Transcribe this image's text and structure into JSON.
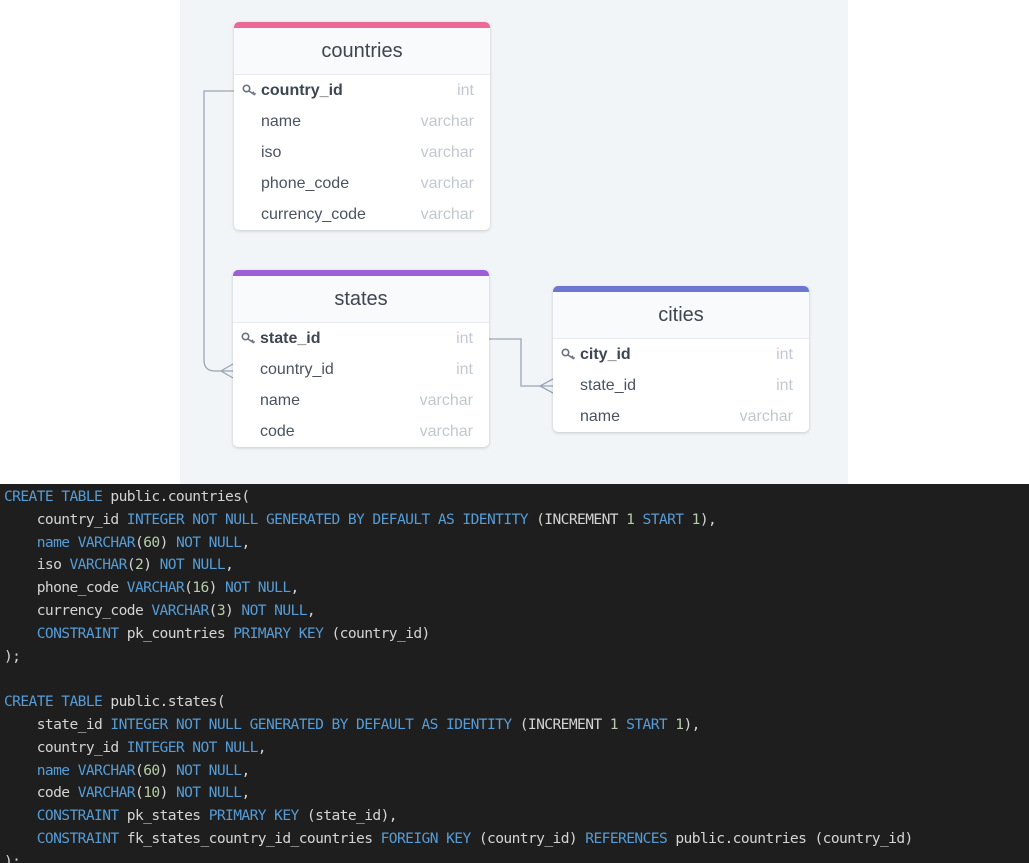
{
  "diagram": {
    "tables": [
      {
        "name": "countries",
        "color": "#ea6a95",
        "fields": [
          {
            "name": "country_id",
            "type": "int",
            "pk": true
          },
          {
            "name": "name",
            "type": "varchar",
            "pk": false
          },
          {
            "name": "iso",
            "type": "varchar",
            "pk": false
          },
          {
            "name": "phone_code",
            "type": "varchar",
            "pk": false
          },
          {
            "name": "currency_code",
            "type": "varchar",
            "pk": false
          }
        ]
      },
      {
        "name": "states",
        "color": "#9c5fd6",
        "fields": [
          {
            "name": "state_id",
            "type": "int",
            "pk": true
          },
          {
            "name": "country_id",
            "type": "int",
            "pk": false
          },
          {
            "name": "name",
            "type": "varchar",
            "pk": false
          },
          {
            "name": "code",
            "type": "varchar",
            "pk": false
          }
        ]
      },
      {
        "name": "cities",
        "color": "#6c78cf",
        "fields": [
          {
            "name": "city_id",
            "type": "int",
            "pk": true
          },
          {
            "name": "state_id",
            "type": "int",
            "pk": false
          },
          {
            "name": "name",
            "type": "varchar",
            "pk": false
          }
        ]
      }
    ]
  },
  "code": {
    "lines": [
      [
        [
          "kw",
          "CREATE TABLE"
        ],
        [
          "p",
          " public.countries("
        ]
      ],
      [
        [
          "p",
          "    country_id "
        ],
        [
          "kw",
          "INTEGER NOT NULL GENERATED BY DEFAULT AS IDENTITY"
        ],
        [
          "p",
          " (INCREMENT "
        ],
        [
          "num",
          "1"
        ],
        [
          "kw",
          " START"
        ],
        [
          "p",
          " "
        ],
        [
          "num",
          "1"
        ],
        [
          "p",
          "),"
        ]
      ],
      [
        [
          "p",
          "    "
        ],
        [
          "kw",
          "name"
        ],
        [
          "p",
          " "
        ],
        [
          "kw",
          "VARCHAR"
        ],
        [
          "p",
          "("
        ],
        [
          "num",
          "60"
        ],
        [
          "p",
          ") "
        ],
        [
          "kw",
          "NOT NULL"
        ],
        [
          "p",
          ","
        ]
      ],
      [
        [
          "p",
          "    iso "
        ],
        [
          "kw",
          "VARCHAR"
        ],
        [
          "p",
          "("
        ],
        [
          "num",
          "2"
        ],
        [
          "p",
          ") "
        ],
        [
          "kw",
          "NOT NULL"
        ],
        [
          "p",
          ","
        ]
      ],
      [
        [
          "p",
          "    phone_code "
        ],
        [
          "kw",
          "VARCHAR"
        ],
        [
          "p",
          "("
        ],
        [
          "num",
          "16"
        ],
        [
          "p",
          ") "
        ],
        [
          "kw",
          "NOT NULL"
        ],
        [
          "p",
          ","
        ]
      ],
      [
        [
          "p",
          "    currency_code "
        ],
        [
          "kw",
          "VARCHAR"
        ],
        [
          "p",
          "("
        ],
        [
          "num",
          "3"
        ],
        [
          "p",
          ") "
        ],
        [
          "kw",
          "NOT NULL"
        ],
        [
          "p",
          ","
        ]
      ],
      [
        [
          "p",
          "    "
        ],
        [
          "kw",
          "CONSTRAINT"
        ],
        [
          "p",
          " pk_countries "
        ],
        [
          "kw",
          "PRIMARY KEY"
        ],
        [
          "p",
          " (country_id)"
        ]
      ],
      [
        [
          "p",
          ");"
        ]
      ],
      [
        [
          "p",
          ""
        ]
      ],
      [
        [
          "kw",
          "CREATE TABLE"
        ],
        [
          "p",
          " public.states("
        ]
      ],
      [
        [
          "p",
          "    state_id "
        ],
        [
          "kw",
          "INTEGER NOT NULL GENERATED BY DEFAULT AS IDENTITY"
        ],
        [
          "p",
          " (INCREMENT "
        ],
        [
          "num",
          "1"
        ],
        [
          "kw",
          " START"
        ],
        [
          "p",
          " "
        ],
        [
          "num",
          "1"
        ],
        [
          "p",
          "),"
        ]
      ],
      [
        [
          "p",
          "    country_id "
        ],
        [
          "kw",
          "INTEGER NOT NULL"
        ],
        [
          "p",
          ","
        ]
      ],
      [
        [
          "p",
          "    "
        ],
        [
          "kw",
          "name"
        ],
        [
          "p",
          " "
        ],
        [
          "kw",
          "VARCHAR"
        ],
        [
          "p",
          "("
        ],
        [
          "num",
          "60"
        ],
        [
          "p",
          ") "
        ],
        [
          "kw",
          "NOT NULL"
        ],
        [
          "p",
          ","
        ]
      ],
      [
        [
          "p",
          "    code "
        ],
        [
          "kw",
          "VARCHAR"
        ],
        [
          "p",
          "("
        ],
        [
          "num",
          "10"
        ],
        [
          "p",
          ") "
        ],
        [
          "kw",
          "NOT NULL"
        ],
        [
          "p",
          ","
        ]
      ],
      [
        [
          "p",
          "    "
        ],
        [
          "kw",
          "CONSTRAINT"
        ],
        [
          "p",
          " pk_states "
        ],
        [
          "kw",
          "PRIMARY KEY"
        ],
        [
          "p",
          " (state_id),"
        ]
      ],
      [
        [
          "p",
          "    "
        ],
        [
          "kw",
          "CONSTRAINT"
        ],
        [
          "p",
          " fk_states_country_id_countries "
        ],
        [
          "kw",
          "FOREIGN KEY"
        ],
        [
          "p",
          " (country_id) "
        ],
        [
          "kw",
          "REFERENCES"
        ],
        [
          "p",
          " public.countries (country_id)"
        ]
      ],
      [
        [
          "p",
          ");"
        ]
      ]
    ]
  }
}
